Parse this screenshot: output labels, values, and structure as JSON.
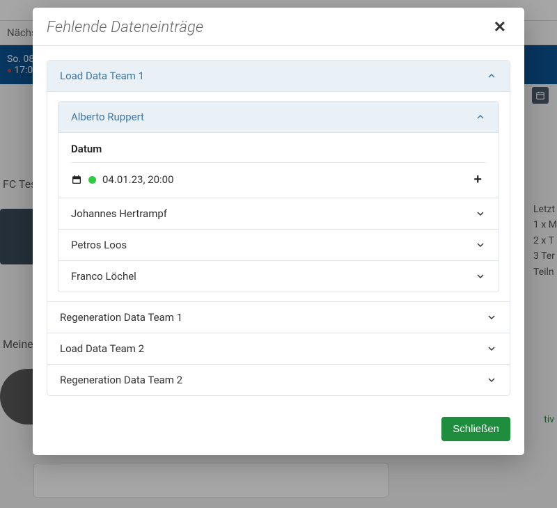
{
  "modal": {
    "title": "Fehlende Dateneinträge",
    "close_button_label": "Schließen",
    "sections": [
      {
        "label": "Load Data Team 1",
        "expanded": true,
        "players": [
          {
            "name": "Alberto Ruppert",
            "expanded": true,
            "datum_header": "Datum",
            "entries": [
              {
                "datetime": "04.01.23, 20:00",
                "status": "green"
              }
            ]
          },
          {
            "name": "Johannes Hertrampf",
            "expanded": false
          },
          {
            "name": "Petros Loos",
            "expanded": false
          },
          {
            "name": "Franco Löchel",
            "expanded": false
          }
        ]
      },
      {
        "label": "Regeneration Data Team 1",
        "expanded": false
      },
      {
        "label": "Load Data Team 2",
        "expanded": false
      },
      {
        "label": "Regeneration Data Team 2",
        "expanded": false
      }
    ]
  },
  "background": {
    "next_label": "Nächs",
    "event_date": "So. 08.",
    "event_time": "17:0",
    "team_label": "FC Tes",
    "meine_label": "Meine",
    "right_summary": [
      "Letzt",
      "1 x M",
      "2 x T",
      "3 Ter",
      "Teiln"
    ],
    "aktiv_label": "tiv"
  }
}
